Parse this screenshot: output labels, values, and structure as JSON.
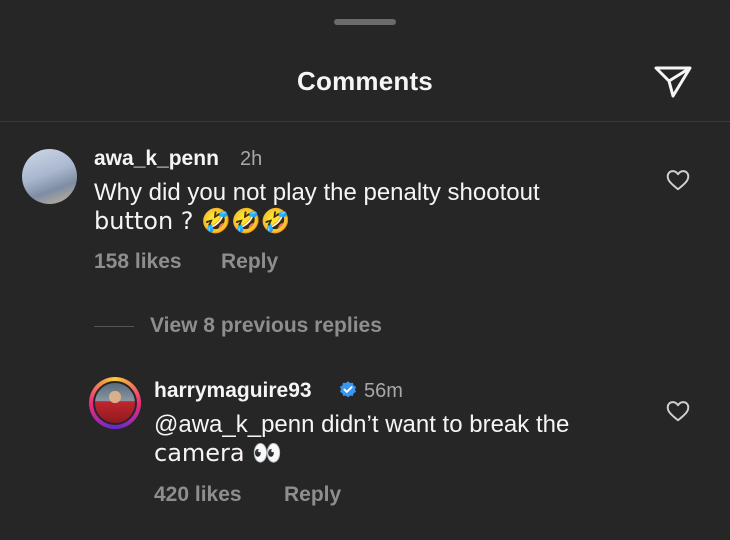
{
  "header": {
    "title": "Comments",
    "share_icon": "send-icon"
  },
  "comments": [
    {
      "username": "awa_k_penn",
      "time": "2h",
      "line1": "Why did you not play the penalty shootout",
      "line2": "button ? 🤣🤣🤣",
      "likes": "158 likes",
      "reply": "Reply"
    }
  ],
  "view_replies": "View 8 previous replies",
  "reply": {
    "username": "harrymaguire93",
    "verified": true,
    "time": "56m",
    "line1": "@awa_k_penn didn’t want to break the",
    "line2": "camera 👀",
    "likes": "420 likes",
    "reply": "Reply"
  },
  "colors": {
    "background": "#262626",
    "verified": "#3897f0",
    "muted": "#8e8e8e"
  }
}
